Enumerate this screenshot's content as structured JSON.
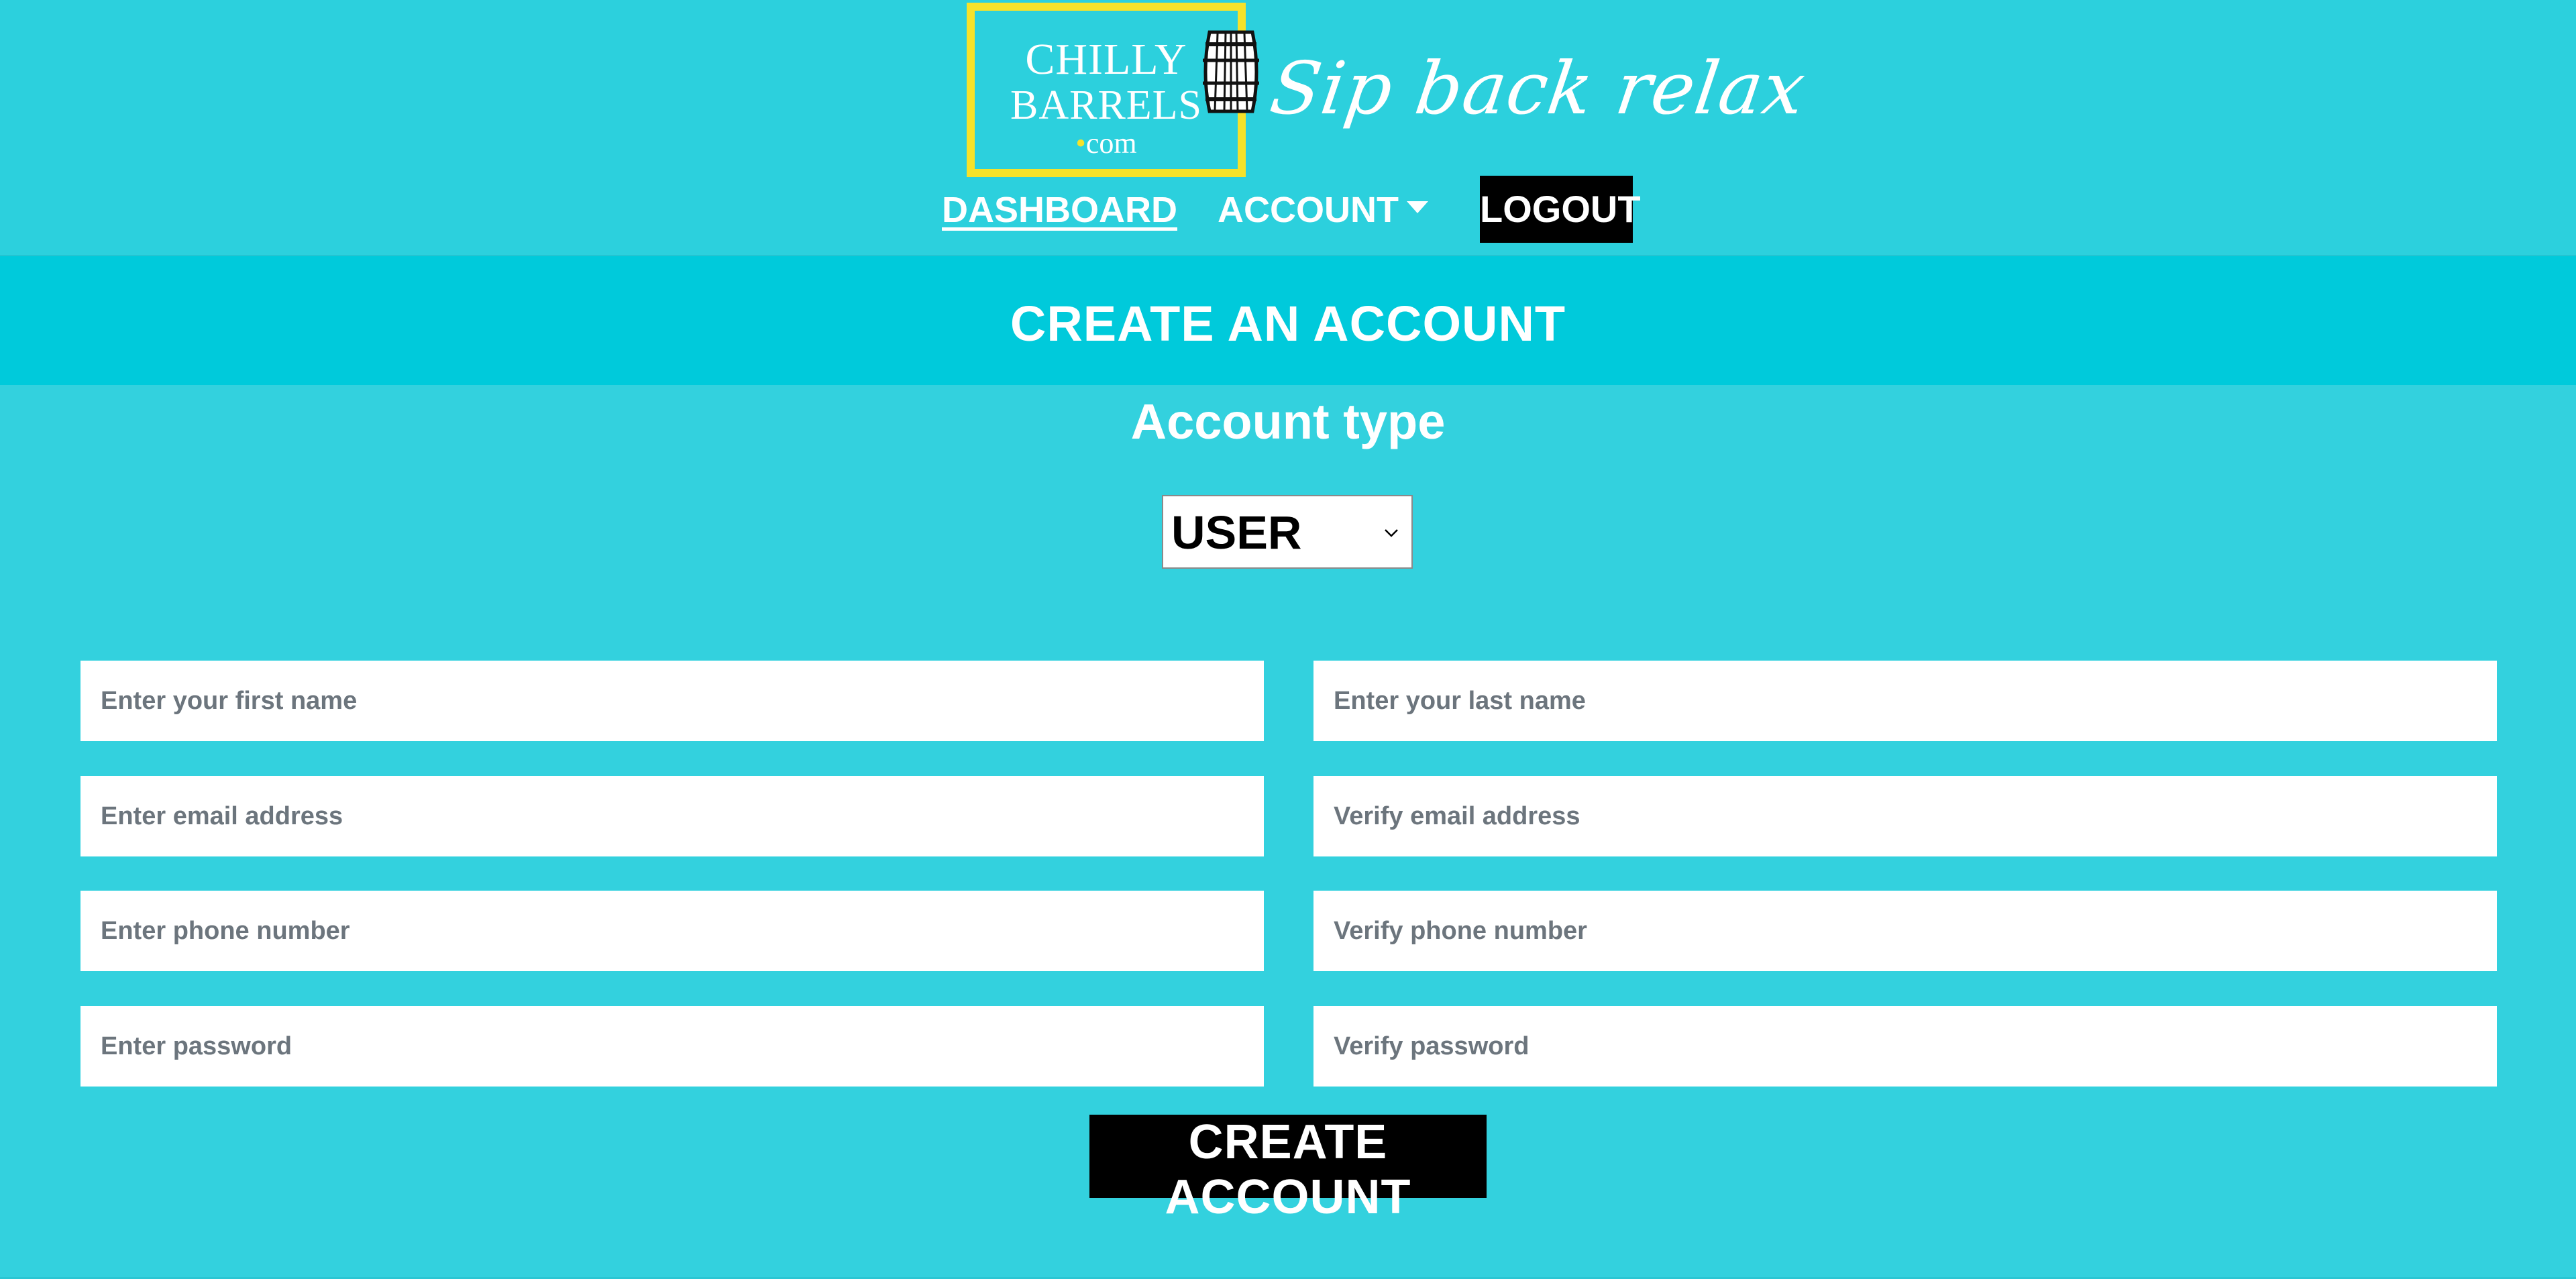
{
  "brand": {
    "logo_line1": "CHILLY",
    "logo_line2": "BARRELS",
    "logo_dot": "•",
    "logo_line3": "com",
    "tagline": "Sip back relax",
    "logo_icon": "barrel-icon",
    "frame_color": "#f6e22a"
  },
  "nav": {
    "dashboard_label": "DASHBOARD",
    "account_label": "ACCOUNT",
    "logout_label": "LOGOUT"
  },
  "page": {
    "title": "CREATE AN ACCOUNT",
    "account_type_label": "Account type",
    "account_type_selected": "USER"
  },
  "form": {
    "first_name_placeholder": "Enter your first name",
    "last_name_placeholder": "Enter your last name",
    "email_placeholder": "Enter email address",
    "verify_email_placeholder": "Verify email address",
    "phone_placeholder": "Enter phone number",
    "verify_phone_placeholder": "Verify phone number",
    "password_placeholder": "Enter password",
    "verify_password_placeholder": "Verify password",
    "submit_label": "CREATE ACCOUNT"
  },
  "colors": {
    "background": "#33d1de",
    "title_band": "#00cadb",
    "button": "#000000",
    "text": "#ffffff"
  }
}
